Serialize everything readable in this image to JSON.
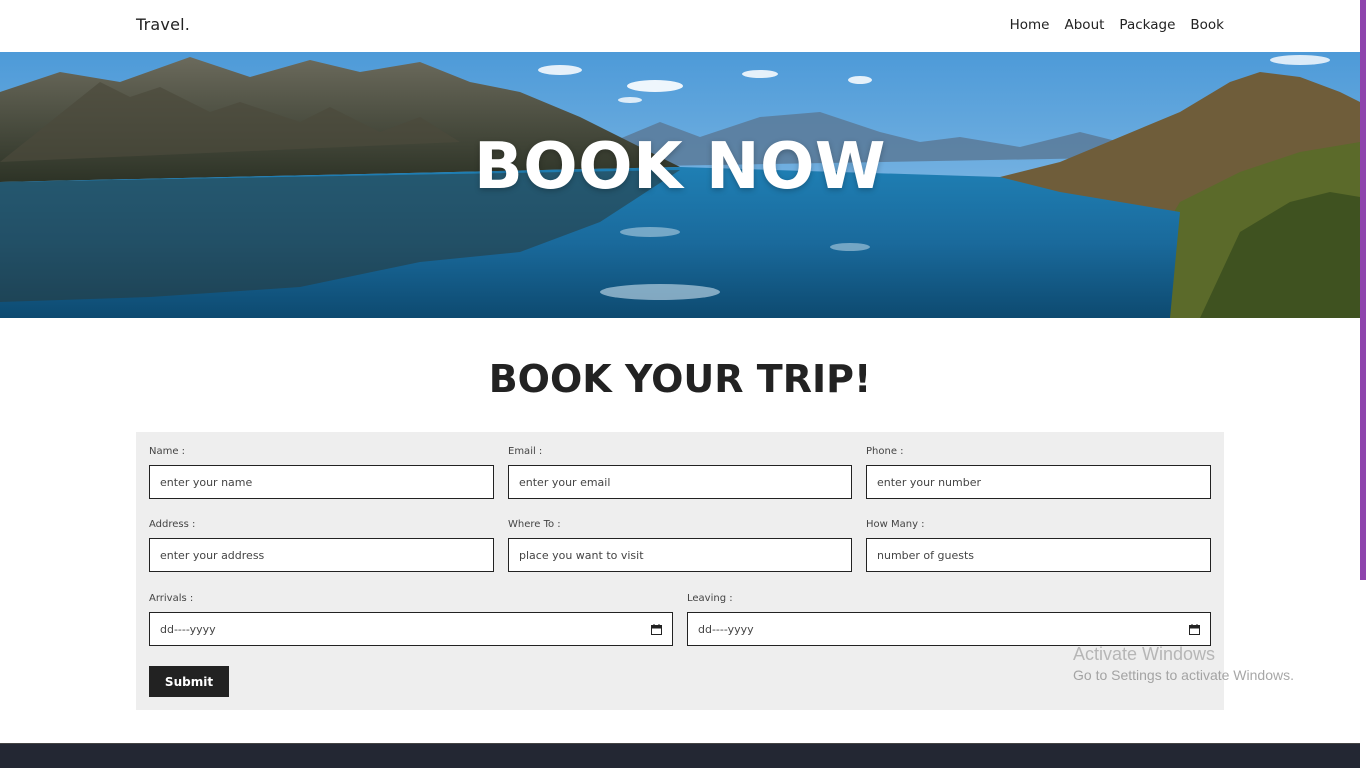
{
  "nav": {
    "brand": "Travel.",
    "links": [
      "Home",
      "About",
      "Package",
      "Book"
    ]
  },
  "hero": {
    "title": "BOOK NOW"
  },
  "section": {
    "title": "BOOK YOUR TRIP!"
  },
  "form": {
    "name": {
      "label": "Name :",
      "placeholder": "enter your name"
    },
    "email": {
      "label": "Email :",
      "placeholder": "enter your email"
    },
    "phone": {
      "label": "Phone :",
      "placeholder": "enter your number"
    },
    "address": {
      "label": "Address :",
      "placeholder": "enter your address"
    },
    "where_to": {
      "label": "Where To :",
      "placeholder": "place you want to visit"
    },
    "how_many": {
      "label": "How Many :",
      "placeholder": "number of guests"
    },
    "arrivals": {
      "label": "Arrivals :",
      "placeholder": "dd----yyyy"
    },
    "leaving": {
      "label": "Leaving :",
      "placeholder": "dd----yyyy"
    },
    "submit_label": "Submit"
  },
  "watermark": {
    "line1": "Activate Windows",
    "line2": "Go to Settings to activate Windows."
  },
  "colors": {
    "accent": "#8e44ad",
    "footer": "#232733",
    "form_bg": "#eeeeee",
    "button": "#222222"
  }
}
